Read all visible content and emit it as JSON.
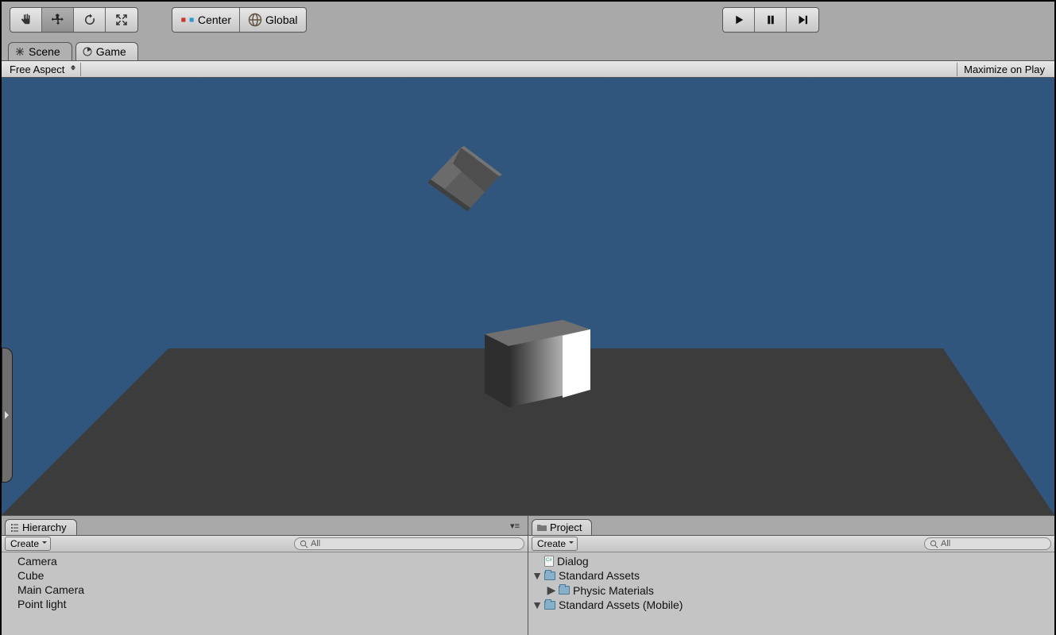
{
  "toolbar": {
    "pivot_label": "Center",
    "space_label": "Global"
  },
  "tabs": {
    "scene": "Scene",
    "game": "Game"
  },
  "gamebar": {
    "aspect": "Free Aspect",
    "maximize": "Maximize on Play"
  },
  "hierarchy": {
    "title": "Hierarchy",
    "create": "Create",
    "search": "All",
    "items": [
      "Camera",
      "Cube",
      "Main Camera",
      "Point light"
    ]
  },
  "project": {
    "title": "Project",
    "create": "Create",
    "search": "All",
    "items": [
      {
        "icon": "script",
        "label": "Dialog",
        "depth": 0,
        "arrow": ""
      },
      {
        "icon": "folder",
        "label": "Standard Assets",
        "depth": 0,
        "arrow": "▼"
      },
      {
        "icon": "folder",
        "label": "Physic Materials",
        "depth": 1,
        "arrow": "▶"
      },
      {
        "icon": "folder",
        "label": "Standard Assets (Mobile)",
        "depth": 0,
        "arrow": "▼"
      }
    ]
  }
}
